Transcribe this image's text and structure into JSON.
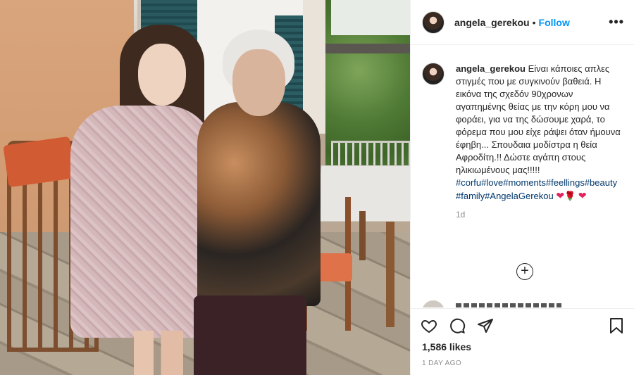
{
  "post": {
    "username": "angela_gerekou",
    "separator": "•",
    "follow_label": "Follow",
    "more_icon": "more-options-icon",
    "more_label": "•••"
  },
  "caption": {
    "username": "angela_gerekou",
    "text": "Είναι κάποιες απλες στιγμές που με συγκινούν βαθειά. Η εικόνα της σχεδόν 90χρονων αγαπημένης θείας με την κόρη μου να φοράει, για να της δώσουμε χαρά, το φόρεμα που μου είχε ράψει όταν ήμουνα έφηβη... Σπουδαια μοδίστρα η θεία Αφροδίτη.!! Δώστε αγάπη στους ηλικιωμένους μας!!!!!",
    "hashtags": "#corfu#love#moments#feellings#beauty#family#AngelaGerekou",
    "emoji_1": "❤",
    "emoji_2": "🌹",
    "emoji_3": "❤",
    "age": "1d"
  },
  "actions": {
    "add_comment": "+",
    "likes": "1,586 likes",
    "date": "1 DAY AGO",
    "icons": [
      "heart-icon",
      "comment-icon",
      "share-icon",
      "save-icon"
    ]
  },
  "colors": {
    "link": "#0095f6",
    "hashtag": "#00376b",
    "muted": "#8e8e8e"
  }
}
